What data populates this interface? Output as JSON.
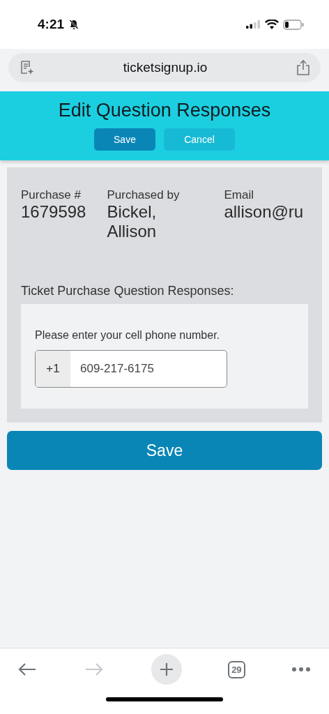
{
  "status_bar": {
    "time": "4:21",
    "silent": true
  },
  "address_bar": {
    "url": "ticketsignup.io"
  },
  "header": {
    "title": "Edit Question Responses",
    "buttons": [
      {
        "label": "Save",
        "kind": "primary"
      },
      {
        "label": "Cancel",
        "kind": "secondary"
      }
    ]
  },
  "purchase": {
    "fields": [
      {
        "label": "Purchase #",
        "value": "1679598"
      },
      {
        "label": "Purchased by",
        "value": "Bickel, Allison"
      },
      {
        "label": "Email",
        "value": "allison@ru"
      }
    ]
  },
  "responses": {
    "heading": "Ticket Purchase Question Responses:",
    "questions": [
      {
        "prompt": "Please enter your cell phone number.",
        "prefix": "+1",
        "value": "609-217-6175"
      }
    ]
  },
  "save_button": {
    "label": "Save"
  },
  "toolbar": {
    "items": [
      {
        "kind": "back",
        "disabled": false
      },
      {
        "kind": "forward",
        "disabled": true
      },
      {
        "kind": "new-tab",
        "disabled": false
      },
      {
        "kind": "tabs",
        "label": "29",
        "disabled": false
      },
      {
        "kind": "more",
        "disabled": false
      }
    ]
  }
}
